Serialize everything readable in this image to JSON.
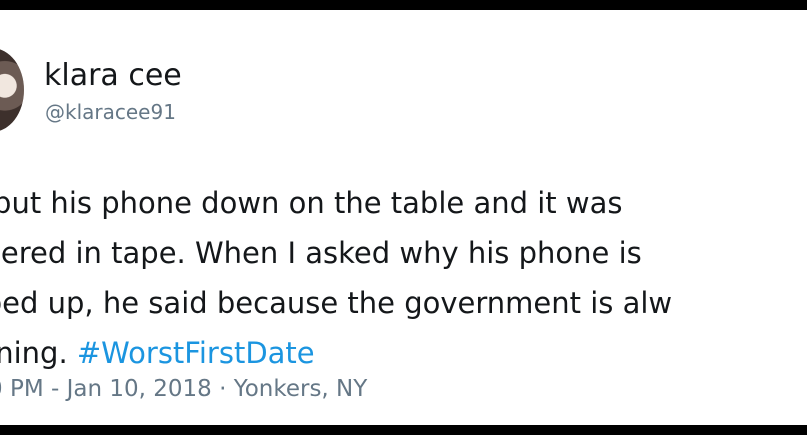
{
  "user": {
    "name": "klara cee",
    "handle": "@klaracee91"
  },
  "tweet": {
    "lines": [
      "e put his phone down on the table and it was",
      "overed in tape. When I asked why his phone is",
      "aped up, he said because the government is alw",
      "tening."
    ],
    "hashtag": "#WorstFirstDate",
    "timestamp": "0 PM - Jan 10, 2018 · Yonkers, NY"
  }
}
